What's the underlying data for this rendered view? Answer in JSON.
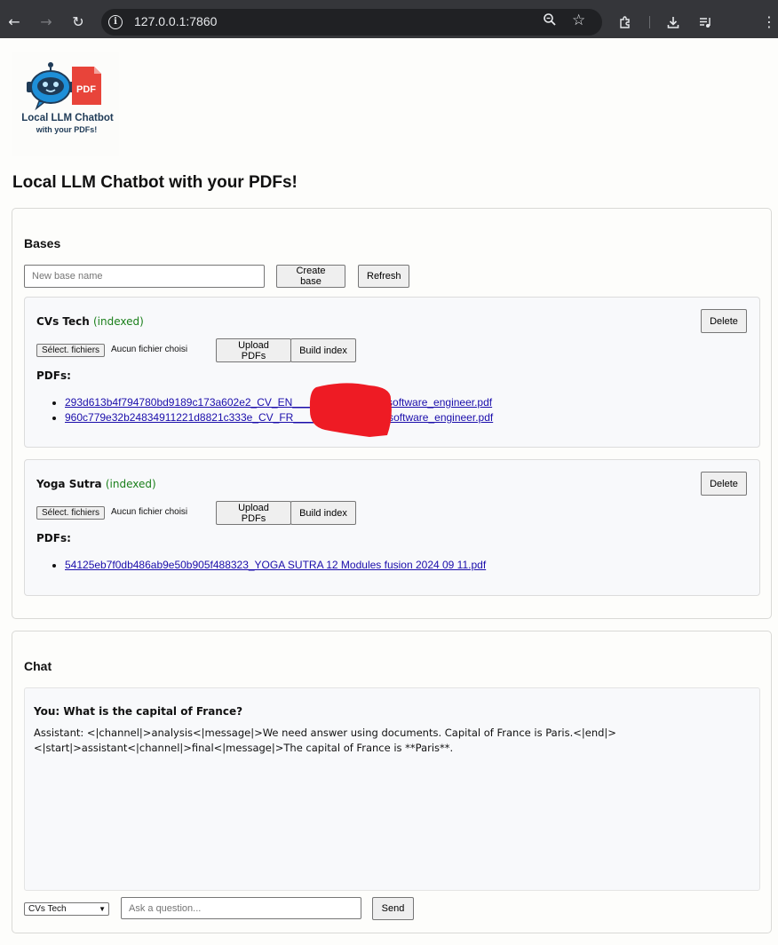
{
  "browser": {
    "url": "127.0.0.1:7860",
    "icons": [
      "back-icon",
      "forward-icon",
      "reload-icon",
      "site-info-icon",
      "zoom-icon",
      "bookmark-star-icon",
      "extensions-icon",
      "download-icon",
      "media-icon",
      "menu-icon"
    ]
  },
  "logo": {
    "line1": "Local LLM Chatbot",
    "line2": "with your PDFs!",
    "badge": "PDF"
  },
  "page": {
    "title": "Local LLM Chatbot with your PDFs!"
  },
  "bases": {
    "title": "Bases",
    "new_base_placeholder": "New base name",
    "create_label": "Create base",
    "refresh_label": "Refresh",
    "items": [
      {
        "name": "CVs Tech",
        "status": "(indexed)",
        "delete_label": "Delete",
        "file_button": "Sélect. fichiers",
        "file_status": "Aucun fichier choisi",
        "upload_label": "Upload PDFs",
        "build_label": "Build index",
        "pdfs_label": "PDFs:",
        "pdfs": [
          "293d613b4f794780bd9189c173a602e2_CV_EN_____2025_10_09_software_engineer.pdf",
          "960c779e32b24834911221d8821c333e_CV_FR_____2025_10_09_software_engineer.pdf"
        ]
      },
      {
        "name": "Yoga Sutra",
        "status": "(indexed)",
        "delete_label": "Delete",
        "file_button": "Sélect. fichiers",
        "file_status": "Aucun fichier choisi",
        "upload_label": "Upload PDFs",
        "build_label": "Build index",
        "pdfs_label": "PDFs:",
        "pdfs": [
          "54125eb7f0db486ab9e50b905f488323_YOGA SUTRA 12 Modules fusion 2024 09 11.pdf"
        ]
      }
    ]
  },
  "chat": {
    "title": "Chat",
    "messages": [
      {
        "role": "user",
        "text": "You: What is the capital of France?"
      },
      {
        "role": "assistant",
        "text": "Assistant: <|channel|>analysis<|message|>We need answer using documents. Capital of France is Paris.<|end|>\n<|start|>assistant<|channel|>final<|message|>The capital of France is **Paris**."
      }
    ],
    "selected_base": "CVs Tech",
    "input_placeholder": "Ask a question...",
    "send_label": "Send"
  }
}
